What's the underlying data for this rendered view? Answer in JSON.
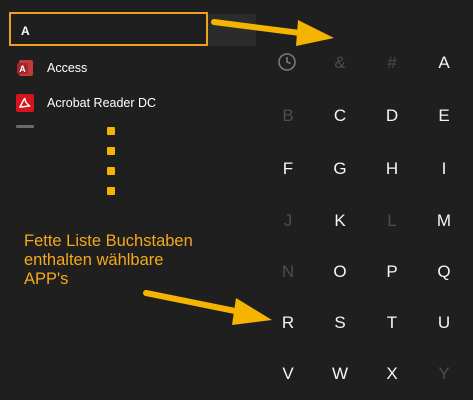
{
  "search": {
    "header_letter": "A"
  },
  "apps": [
    {
      "label": "Access",
      "icon": "access-icon"
    },
    {
      "label": "Acrobat Reader DC",
      "icon": "acrobat-icon"
    }
  ],
  "letter_grid": [
    {
      "char": "&",
      "enabled": false
    },
    {
      "char": "#",
      "enabled": false
    },
    {
      "char": "A",
      "enabled": true
    },
    {
      "char": "B",
      "enabled": false
    },
    {
      "char": "C",
      "enabled": true
    },
    {
      "char": "D",
      "enabled": true
    },
    {
      "char": "E",
      "enabled": true
    },
    {
      "char": "F",
      "enabled": true
    },
    {
      "char": "G",
      "enabled": true
    },
    {
      "char": "H",
      "enabled": true
    },
    {
      "char": "I",
      "enabled": true
    },
    {
      "char": "J",
      "enabled": false
    },
    {
      "char": "K",
      "enabled": true
    },
    {
      "char": "L",
      "enabled": false
    },
    {
      "char": "M",
      "enabled": true
    },
    {
      "char": "N",
      "enabled": false
    },
    {
      "char": "O",
      "enabled": true
    },
    {
      "char": "P",
      "enabled": true
    },
    {
      "char": "Q",
      "enabled": true
    },
    {
      "char": "R",
      "enabled": true
    },
    {
      "char": "S",
      "enabled": true
    },
    {
      "char": "T",
      "enabled": true
    },
    {
      "char": "U",
      "enabled": true
    },
    {
      "char": "V",
      "enabled": true
    },
    {
      "char": "W",
      "enabled": true
    },
    {
      "char": "X",
      "enabled": true
    },
    {
      "char": "Y",
      "enabled": false
    }
  ],
  "annotation": {
    "lines": [
      "Fette Liste Buchstaben",
      "enthalten wählbare",
      "APP's"
    ]
  },
  "colors": {
    "highlight": "#f0a020",
    "annotation": "#f4a81c",
    "letter_enabled": "#f5f5f5",
    "letter_disabled": "#4d4d4d",
    "background": "#1f1f1f"
  },
  "icons": {
    "recent": "clock-icon"
  }
}
